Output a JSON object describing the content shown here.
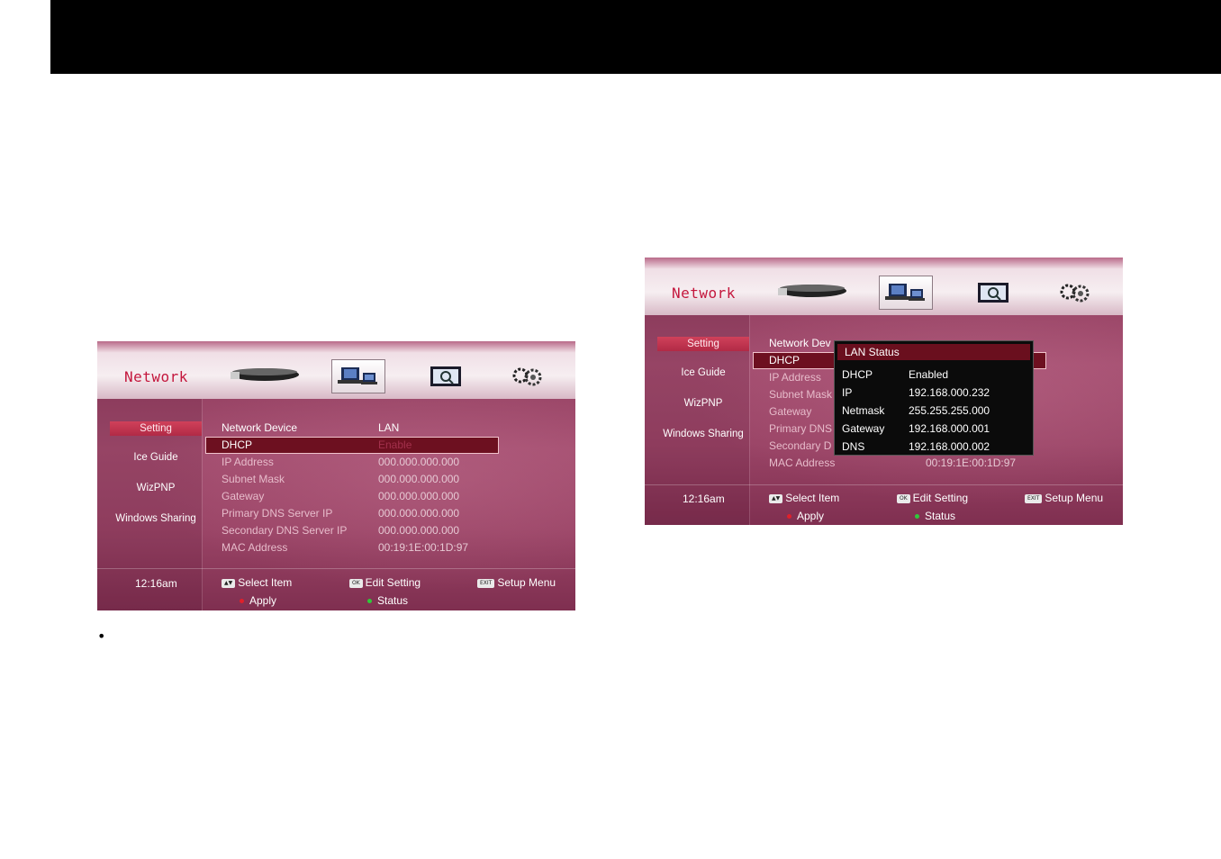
{
  "screens": [
    {
      "title": "Network",
      "sidebar": [
        "Setting",
        "Ice Guide",
        "WizPNP",
        "Windows Sharing"
      ],
      "clock": "12:16am",
      "rows": [
        {
          "label": "Network Device",
          "value": "LAN"
        },
        {
          "label": "DHCP",
          "value": "Enable"
        },
        {
          "label": "IP Address",
          "value": "000.000.000.000"
        },
        {
          "label": "Subnet Mask",
          "value": "000.000.000.000"
        },
        {
          "label": "Gateway",
          "value": "000.000.000.000"
        },
        {
          "label": "Primary DNS Server IP",
          "value": "000.000.000.000"
        },
        {
          "label": "Secondary DNS Server IP",
          "value": "000.000.000.000"
        },
        {
          "label": "MAC Address",
          "value": "00:19:1E:00:1D:97"
        }
      ],
      "footer": {
        "select_key": "▲▼",
        "select": "Select Item",
        "ok_key": "OK",
        "edit": "Edit Setting",
        "exit_key": "EXIT",
        "setup": "Setup Menu",
        "apply": "Apply",
        "status": "Status"
      }
    },
    {
      "title": "Network",
      "sidebar": [
        "Setting",
        "Ice Guide",
        "WizPNP",
        "Windows Sharing"
      ],
      "clock": "12:16am",
      "rows": [
        {
          "label": "Network Dev",
          "value": ""
        },
        {
          "label": "DHCP",
          "value": ""
        },
        {
          "label": "IP Address",
          "value": ""
        },
        {
          "label": "Subnet Mask",
          "value": ""
        },
        {
          "label": "Gateway",
          "value": ""
        },
        {
          "label": "Primary DNS",
          "value": ""
        },
        {
          "label": "Secondary D",
          "value": ""
        },
        {
          "label": "MAC Address",
          "value": "00:19:1E:00:1D:97"
        }
      ],
      "popup": {
        "title": "LAN Status",
        "rows": [
          {
            "label": "DHCP",
            "value": "Enabled"
          },
          {
            "label": "IP",
            "value": "192.168.000.232"
          },
          {
            "label": "Netmask",
            "value": "255.255.255.000"
          },
          {
            "label": "Gateway",
            "value": "192.168.000.001"
          },
          {
            "label": "DNS",
            "value": "192.168.000.002"
          }
        ]
      },
      "footer": {
        "select_key": "▲▼",
        "select": "Select Item",
        "ok_key": "OK",
        "edit": "Edit Setting",
        "exit_key": "EXIT",
        "setup": "Setup Menu",
        "apply": "Apply",
        "status": "Status"
      }
    }
  ],
  "colors": {
    "accent": "#c4173d",
    "highlight": "#6d1020",
    "apply_dot": "#e0202a",
    "status_dot": "#2fc83a"
  },
  "bullet": "•"
}
